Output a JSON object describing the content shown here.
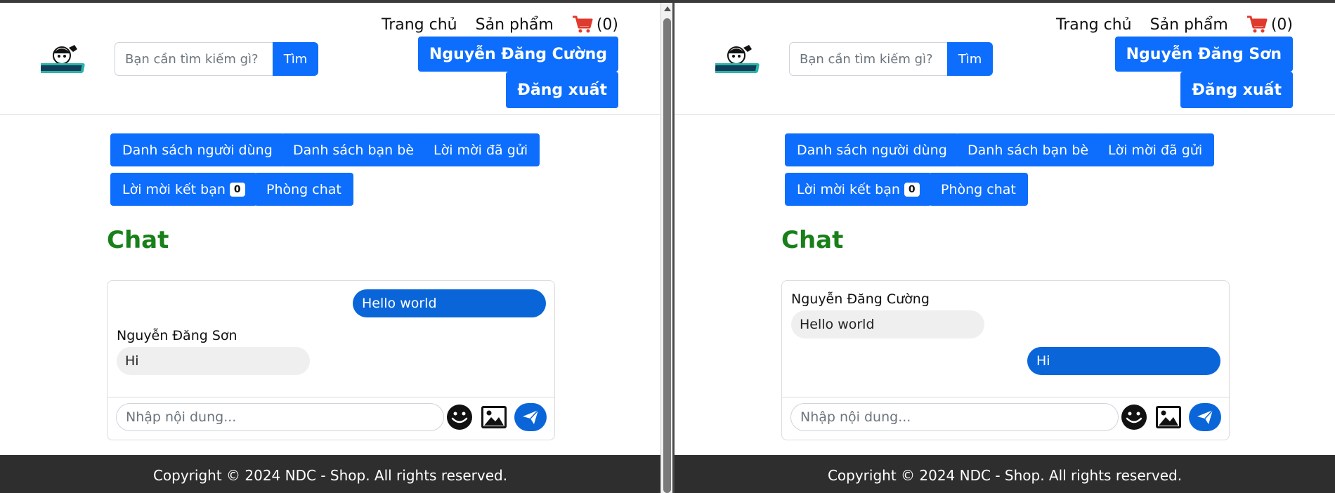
{
  "nav": {
    "home": "Trang chủ",
    "products": "Sản phẩm",
    "cart_count": "(0)"
  },
  "search": {
    "placeholder": "Bạn cần tìm kiếm gì?",
    "button": "Tìm"
  },
  "auth": {
    "logout": "Đăng xuất"
  },
  "tabs": {
    "users": "Danh sách người dùng",
    "friends": "Danh sách bạn bè",
    "sent": "Lời mời đã gửi",
    "requests": "Lời mời kết bạn",
    "requests_count": "0",
    "chatroom": "Phòng chat"
  },
  "chat": {
    "title": "Chat",
    "input_placeholder": "Nhập nội dung..."
  },
  "footer": {
    "copyright": "Copyright © 2024 NDC - Shop. All rights reserved."
  },
  "windows": {
    "left": {
      "user_name": "Nguyễn Đăng Cường",
      "messages": [
        {
          "direction": "out",
          "text": "Hello world"
        },
        {
          "direction": "in",
          "sender": "Nguyễn Đăng Sơn",
          "text": "Hi"
        }
      ]
    },
    "right": {
      "user_name": "Nguyễn Đăng Sơn",
      "messages": [
        {
          "direction": "in",
          "sender": "Nguyễn Đăng Cường",
          "text": "Hello world"
        },
        {
          "direction": "out",
          "text": "Hi"
        }
      ]
    }
  },
  "colors": {
    "primary": "#0d6efd",
    "chat_title": "#198019",
    "cart_icon": "#e03a2f",
    "footer_bg": "#2e2e2e"
  },
  "icons": [
    "logo",
    "cart-icon",
    "emoji-icon",
    "image-icon",
    "send-icon"
  ]
}
